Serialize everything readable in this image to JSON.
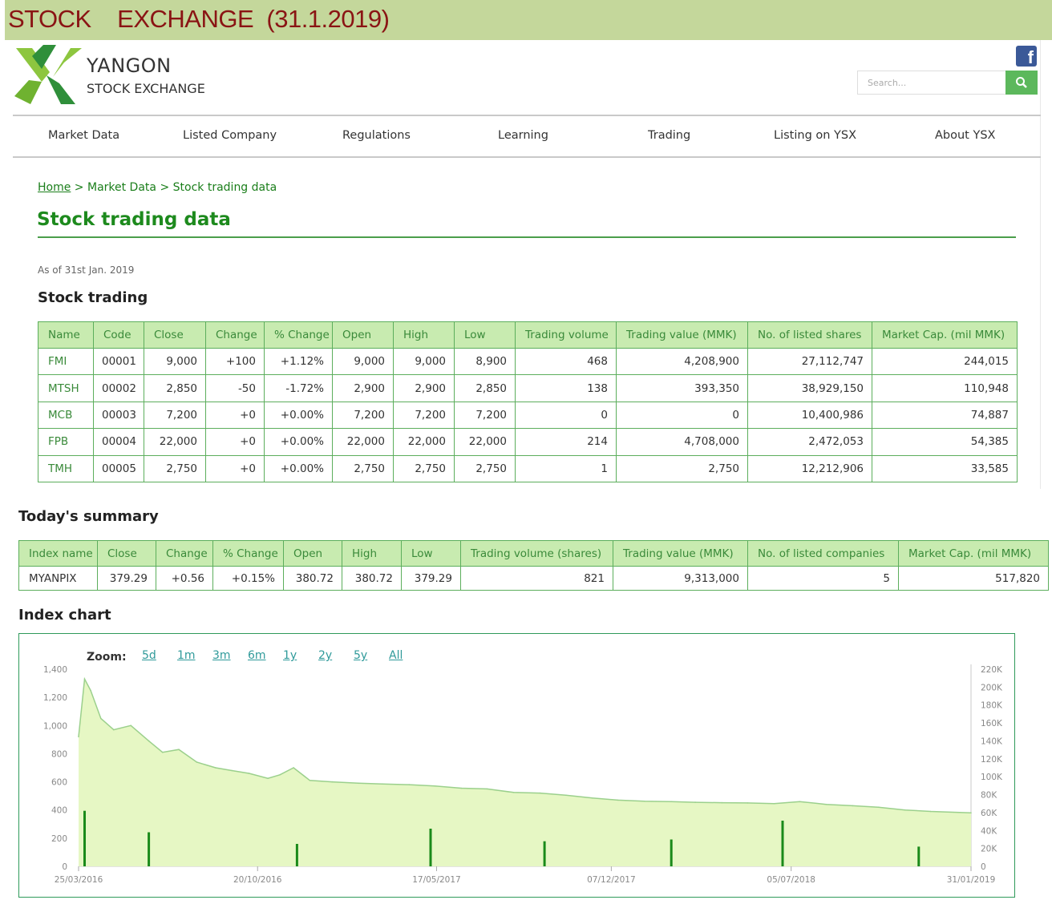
{
  "banner": {
    "title": "STOCK    EXCHANGE  (31.1.2019)"
  },
  "brand": {
    "name": "YANGON",
    "sub": "STOCK EXCHANGE"
  },
  "search": {
    "placeholder": "Search..."
  },
  "icons": {
    "facebook": "facebook-icon",
    "search": "search-icon",
    "logo": "ysx-logo"
  },
  "nav": [
    "Market Data",
    "Listed Company",
    "Regulations",
    "Learning",
    "Trading",
    "Listing on YSX",
    "About YSX"
  ],
  "breadcrumb": {
    "home": "Home",
    "sep": ">",
    "market": "Market Data",
    "current": "Stock trading data"
  },
  "page": {
    "title": "Stock trading data",
    "as_of": "As of 31st Jan. 2019"
  },
  "stock": {
    "title": "Stock trading",
    "headers": [
      "Name",
      "Code",
      "Close",
      "Change",
      "% Change",
      "Open",
      "High",
      "Low",
      "Trading volume",
      "Trading value (MMK)",
      "No. of listed shares",
      "Market Cap. (mil MMK)"
    ],
    "rows": [
      [
        "FMI",
        "00001",
        "9,000",
        "+100",
        "+1.12%",
        "9,000",
        "9,000",
        "8,900",
        "468",
        "4,208,900",
        "27,112,747",
        "244,015"
      ],
      [
        "MTSH",
        "00002",
        "2,850",
        "-50",
        "-1.72%",
        "2,900",
        "2,900",
        "2,850",
        "138",
        "393,350",
        "38,929,150",
        "110,948"
      ],
      [
        "MCB",
        "00003",
        "7,200",
        "+0",
        "+0.00%",
        "7,200",
        "7,200",
        "7,200",
        "0",
        "0",
        "10,400,986",
        "74,887"
      ],
      [
        "FPB",
        "00004",
        "22,000",
        "+0",
        "+0.00%",
        "22,000",
        "22,000",
        "22,000",
        "214",
        "4,708,000",
        "2,472,053",
        "54,385"
      ],
      [
        "TMH",
        "00005",
        "2,750",
        "+0",
        "+0.00%",
        "2,750",
        "2,750",
        "2,750",
        "1",
        "2,750",
        "12,212,906",
        "33,585"
      ]
    ]
  },
  "summary": {
    "title": "Today's summary",
    "headers": [
      "Index name",
      "Close",
      "Change",
      "% Change",
      "Open",
      "High",
      "Low",
      "Trading volume (shares)",
      "Trading value (MMK)",
      "No. of listed companies",
      "Market Cap. (mil MMK)"
    ],
    "rows": [
      [
        "MYANPIX",
        "379.29",
        "+0.56",
        "+0.15%",
        "380.72",
        "380.72",
        "379.29",
        "821",
        "9,313,000",
        "5",
        "517,820"
      ]
    ]
  },
  "chart": {
    "title": "Index chart",
    "zoom_label": "Zoom:",
    "zoom_options": [
      "5d",
      "1m",
      "3m",
      "6m",
      "1y",
      "2y",
      "5y",
      "All"
    ]
  },
  "chart_data": {
    "type": "area",
    "x_ticks": [
      "25/03/2016",
      "20/10/2016",
      "17/05/2017",
      "07/12/2017",
      "05/07/2018",
      "31/01/2019"
    ],
    "y_left_ticks": [
      "0",
      "200",
      "400",
      "600",
      "800",
      "1,000",
      "1,200",
      "1,400"
    ],
    "y_right_ticks": [
      "0",
      "20K",
      "40K",
      "60K",
      "80K",
      "100K",
      "120K",
      "140K",
      "160K",
      "180K",
      "200K",
      "220K"
    ],
    "ylim_left": [
      0,
      1400
    ],
    "ylim_right": [
      0,
      220000
    ],
    "series": [
      {
        "kind": "area",
        "color": "#9bd08c",
        "fill": "#e6f7c4",
        "x": [
          "25/03/2016",
          "01/04/2016",
          "08/04/2016",
          "20/04/2016",
          "05/05/2016",
          "25/05/2016",
          "15/06/2016",
          "01/07/2016",
          "20/07/2016",
          "10/08/2016",
          "01/09/2016",
          "20/09/2016",
          "10/10/2016",
          "01/11/2016",
          "15/11/2016",
          "01/12/2016",
          "20/12/2016",
          "15/01/2017",
          "15/02/2017",
          "15/03/2017",
          "15/04/2017",
          "15/05/2017",
          "15/06/2017",
          "15/07/2017",
          "15/08/2017",
          "15/09/2017",
          "15/10/2017",
          "15/11/2017",
          "15/12/2017",
          "15/01/2018",
          "15/02/2018",
          "15/03/2018",
          "15/04/2018",
          "15/05/2018",
          "15/06/2018",
          "15/07/2018",
          "15/08/2018",
          "15/09/2018",
          "15/10/2018",
          "15/11/2018",
          "15/12/2018",
          "31/01/2019"
        ],
        "y": [
          920,
          1330,
          1250,
          1050,
          970,
          1000,
          890,
          810,
          830,
          740,
          700,
          680,
          660,
          625,
          650,
          700,
          610,
          600,
          590,
          585,
          580,
          570,
          555,
          550,
          525,
          520,
          505,
          485,
          470,
          462,
          460,
          455,
          452,
          450,
          445,
          460,
          440,
          430,
          420,
          400,
          390,
          380
        ]
      },
      {
        "kind": "bar",
        "color": "#1a8a1a",
        "x": [
          "01/04/2016",
          "15/06/2016",
          "05/12/2016",
          "10/05/2017",
          "20/09/2017",
          "15/02/2018",
          "25/06/2018",
          "01/12/2018"
        ],
        "y": [
          62000,
          38000,
          25000,
          42000,
          28000,
          30000,
          51000,
          22000
        ]
      }
    ]
  }
}
